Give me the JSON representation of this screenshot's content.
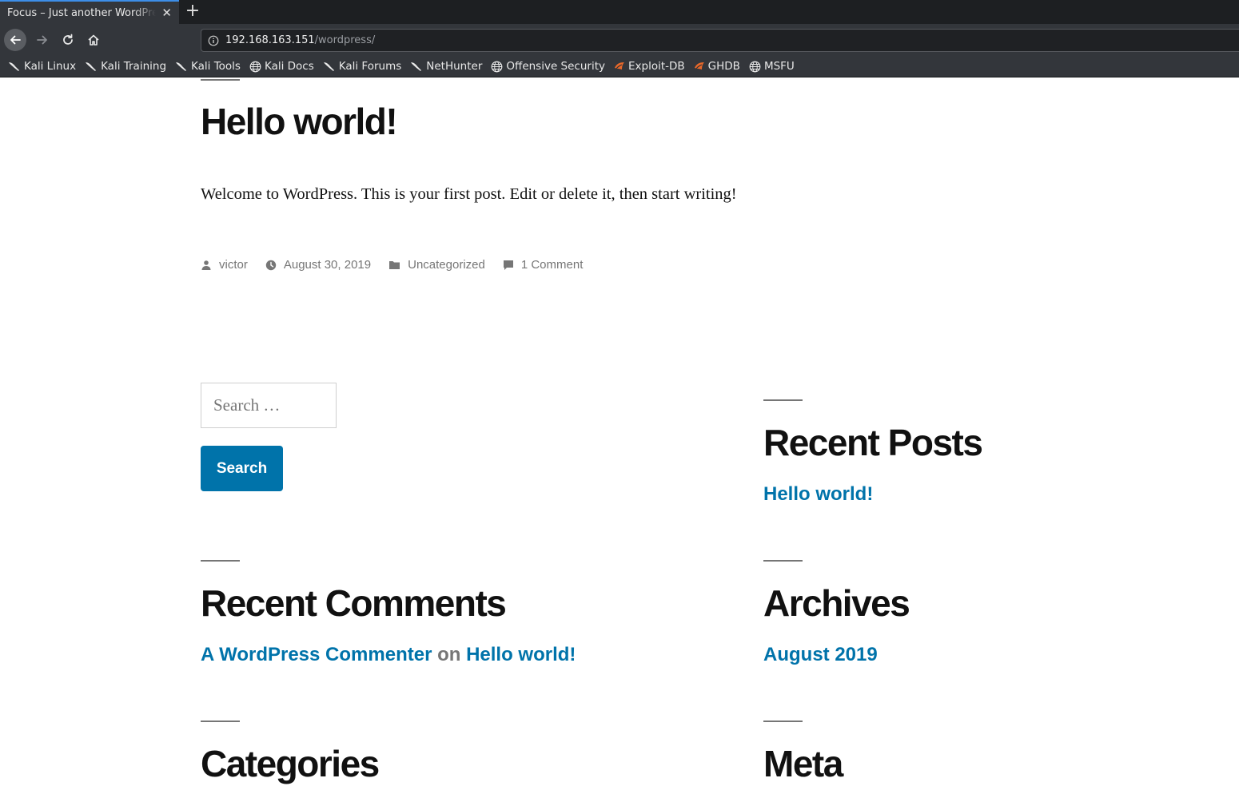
{
  "browser": {
    "tab_title": "Focus – Just another WordPress site",
    "tab_close": "✕",
    "new_tab": "+",
    "url_host": "192.168.163.151",
    "url_path": "/wordpress/"
  },
  "bookmarks": [
    {
      "label": "Kali Linux",
      "icon": "kali-dragon-icon"
    },
    {
      "label": "Kali Training",
      "icon": "kali-dragon-icon"
    },
    {
      "label": "Kali Tools",
      "icon": "kali-dragon-icon"
    },
    {
      "label": "Kali Docs",
      "icon": "globe-icon"
    },
    {
      "label": "Kali Forums",
      "icon": "kali-dragon-icon"
    },
    {
      "label": "NetHunter",
      "icon": "kali-dragon-icon"
    },
    {
      "label": "Offensive Security",
      "icon": "globe-icon"
    },
    {
      "label": "Exploit-DB",
      "icon": "exploitdb-icon"
    },
    {
      "label": "GHDB",
      "icon": "exploitdb-icon"
    },
    {
      "label": "MSFU",
      "icon": "globe-icon"
    }
  ],
  "post": {
    "title": "Hello world!",
    "body": "Welcome to WordPress. This is your first post. Edit or delete it, then start writing!",
    "author": "victor",
    "date": "August 30, 2019",
    "category": "Uncategorized",
    "comments": "1 Comment"
  },
  "search": {
    "placeholder": "Search …",
    "button_label": "Search"
  },
  "widgets": {
    "recent_posts": {
      "title": "Recent Posts",
      "items": [
        "Hello world!"
      ]
    },
    "recent_comments": {
      "title": "Recent Comments",
      "author": "A WordPress Commenter",
      "on": "on",
      "post": "Hello world!"
    },
    "archives": {
      "title": "Archives",
      "items": [
        "August 2019"
      ]
    },
    "categories": {
      "title": "Categories"
    },
    "meta": {
      "title": "Meta"
    }
  },
  "colors": {
    "link": "#0073aa",
    "meta_text": "#767676",
    "chrome": "#33363b"
  }
}
